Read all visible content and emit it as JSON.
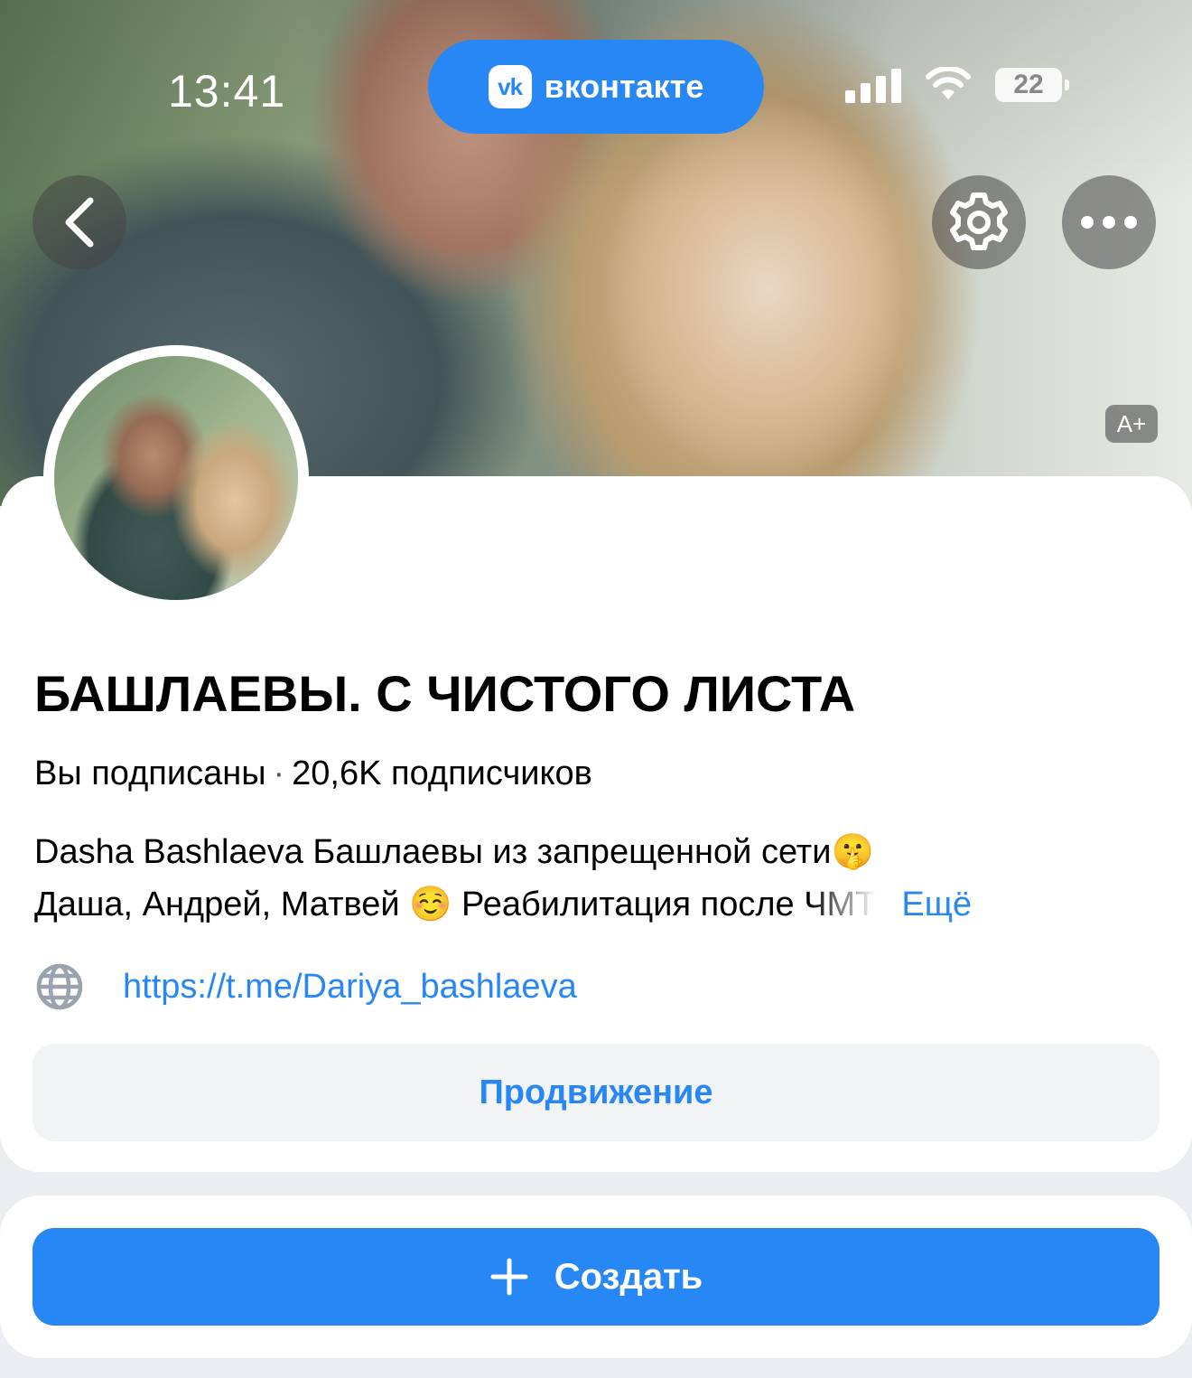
{
  "status_bar": {
    "time": "13:41",
    "app_name": "вконтакте",
    "app_logo": "vk",
    "battery": "22"
  },
  "cover": {
    "font_size_badge": "A+"
  },
  "community": {
    "title": "БАШЛАЕВЫ. С ЧИСТОГО ЛИСТА",
    "subscribed": "Вы подписаны",
    "subscribers": "20,6K подписчиков",
    "description_line1": "Dasha Bashlaeva  Башлаевы из запрещенной сети🤫",
    "description_line2": "Даша, Андрей, Матвей ☺️ Реабилитация после ЧМТ",
    "more": "Ещё",
    "link": "https://t.me/Dariya_bashlaeva"
  },
  "buttons": {
    "promotion": "Продвижение",
    "create": "Создать"
  },
  "colors": {
    "accent": "#2787f5",
    "secondary_bg": "#f2f3f5",
    "page_bg": "#ebedf0"
  }
}
